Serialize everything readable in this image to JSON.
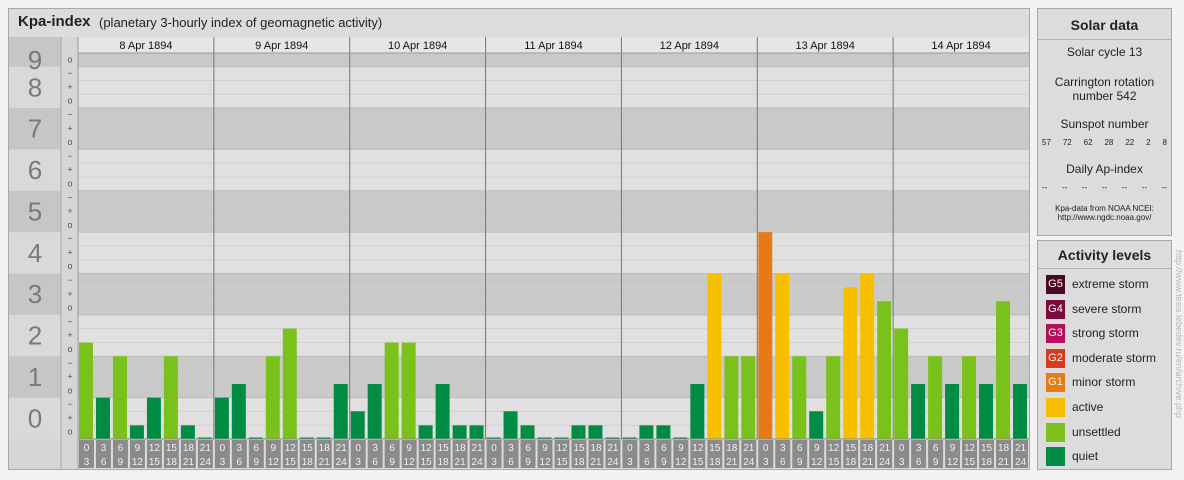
{
  "header": {
    "title": "Kpa-index",
    "subtitle": "(planetary 3-hourly index of geomagnetic activity)"
  },
  "chart_data": {
    "type": "bar",
    "title": "Kpa-index",
    "subtitle": "(planetary 3-hourly index of geomagnetic activity)",
    "ylim": [
      0,
      9.33
    ],
    "y_ticks": [
      "0",
      "1",
      "2",
      "3",
      "4",
      "5",
      "6",
      "7",
      "8",
      "9"
    ],
    "minor_tick_marks": [
      "o",
      "+",
      "−"
    ],
    "grid": true,
    "days": [
      "8 Apr 1894",
      "9 Apr 1894",
      "10 Apr 1894",
      "11 Apr 1894",
      "12 Apr 1894",
      "13 Apr 1894",
      "14 Apr 1894"
    ],
    "interval_labels": [
      [
        "0",
        "3"
      ],
      [
        "3",
        "6"
      ],
      [
        "6",
        "9"
      ],
      [
        "9",
        "12"
      ],
      [
        "12",
        "15"
      ],
      [
        "15",
        "18"
      ],
      [
        "18",
        "21"
      ],
      [
        "21",
        "24"
      ]
    ],
    "series": [
      {
        "day": "8 Apr 1894",
        "values": [
          2.33,
          1.0,
          2.0,
          0.33,
          1.0,
          2.0,
          0.33,
          0.0
        ]
      },
      {
        "day": "9 Apr 1894",
        "values": [
          1.0,
          1.33,
          0.0,
          2.0,
          2.67,
          0.0,
          0.0,
          1.33
        ]
      },
      {
        "day": "10 Apr 1894",
        "values": [
          0.67,
          1.33,
          2.33,
          2.33,
          0.33,
          1.33,
          0.33,
          0.33
        ]
      },
      {
        "day": "11 Apr 1894",
        "values": [
          0.0,
          0.67,
          0.33,
          0.0,
          0.0,
          0.33,
          0.33,
          0.0
        ]
      },
      {
        "day": "12 Apr 1894",
        "values": [
          0.0,
          0.33,
          0.33,
          0.0,
          1.33,
          4.0,
          2.0,
          2.0
        ]
      },
      {
        "day": "13 Apr 1894",
        "values": [
          5.0,
          4.0,
          2.0,
          0.67,
          2.0,
          3.67,
          4.0,
          3.33
        ]
      },
      {
        "day": "14 Apr 1894",
        "values": [
          2.67,
          1.33,
          2.0,
          1.33,
          2.0,
          1.33,
          3.33,
          1.33
        ]
      }
    ],
    "colors": {
      "quiet": "#008c45",
      "unsettled": "#7ac11c",
      "active": "#f6c000",
      "minor_storm": "#e67a17"
    },
    "level_thresholds": {
      "quiet_below": 1.67,
      "unsettled_below": 3.67,
      "active_below": 4.67,
      "minor_storm_below": 5.67
    }
  },
  "solar": {
    "title": "Solar data",
    "cycle": "Solar cycle 13",
    "carrington": "Carrington rotation number 542",
    "sunspot_label": "Sunspot number",
    "sunspot_values": [
      "57",
      "72",
      "62",
      "28",
      "22",
      "2",
      "8"
    ],
    "ap_label": "Daily Ap-index",
    "ap_values": [
      "--",
      "--",
      "--",
      "--",
      "--",
      "--",
      "--"
    ],
    "source_line1": "Kpa-data from NOAA NCEI:",
    "source_line2": "http://www.ngdc.noaa.gov/"
  },
  "activity": {
    "title": "Activity levels",
    "items": [
      {
        "code": "G5",
        "label": "extreme storm",
        "color": "#4a0a23"
      },
      {
        "code": "G4",
        "label": "severe storm",
        "color": "#7a0b3c"
      },
      {
        "code": "G3",
        "label": "strong storm",
        "color": "#b4105a"
      },
      {
        "code": "G2",
        "label": "moderate storm",
        "color": "#d83b1c"
      },
      {
        "code": "G1",
        "label": "minor storm",
        "color": "#e67a17"
      },
      {
        "code": "",
        "label": "active",
        "color": "#f6c000"
      },
      {
        "code": "",
        "label": "unsettled",
        "color": "#7ac11c"
      },
      {
        "code": "",
        "label": "quiet",
        "color": "#008c45"
      }
    ]
  },
  "credit": "http://www.tesis.lebedev.ru/en/archive.php"
}
